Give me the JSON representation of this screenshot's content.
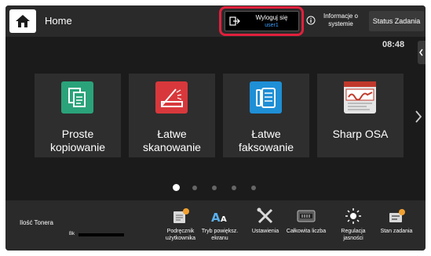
{
  "header": {
    "home_label": "Home",
    "logout": {
      "label": "Wyloguj się",
      "user": "user1"
    },
    "info_label": "Informacje o systemie",
    "status_label": "Status Zadania",
    "clock": "08:48"
  },
  "apps": [
    {
      "label": "Proste kopiowanie",
      "icon": "copy-icon",
      "color": "#2aa37a"
    },
    {
      "label": "Łatwe skanowanie",
      "icon": "scanner-icon",
      "color": "#d8383c"
    },
    {
      "label": "Łatwe faksowanie",
      "icon": "fax-icon",
      "color": "#1f8fd6"
    },
    {
      "label": "Sharp OSA",
      "icon": "osa-logo",
      "color": "#e5e5e5"
    }
  ],
  "pagination": {
    "pages": 5,
    "current": 1
  },
  "toner": {
    "label": "Ilość Tonera",
    "color_label": "Bk"
  },
  "bottom_items": [
    {
      "label": "Podręcznik użytkownika",
      "icon": "manual-icon"
    },
    {
      "label": "Tryb powiększ. ekranu",
      "icon": "text-zoom-icon"
    },
    {
      "label": "Ustawienia",
      "icon": "settings-tools-icon"
    },
    {
      "label": "Całkowita liczba",
      "icon": "counter-icon"
    },
    {
      "label": "Regulacja jasności",
      "icon": "brightness-icon"
    },
    {
      "label": "Stan zadania",
      "icon": "job-status-icon"
    }
  ],
  "colors": {
    "highlight": "#e0203c",
    "user_text": "#3aa0ff"
  }
}
